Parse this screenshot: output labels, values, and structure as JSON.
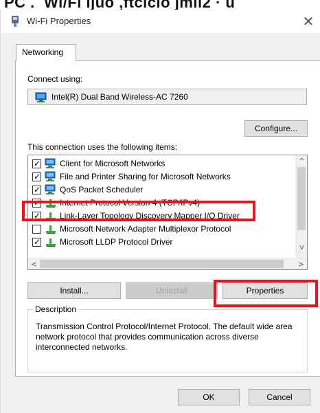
{
  "window": {
    "title": "Wi-Fi Properties",
    "close_glyph": "✕"
  },
  "tabs": [
    {
      "label": "Networking"
    }
  ],
  "connect": {
    "label": "Connect using:",
    "adapter_name": "Intel(R) Dual Band Wireless-AC 7260",
    "adapter_icon": "network-adapter-icon",
    "configure_label": "Configure..."
  },
  "items_list": {
    "label": "This connection uses the following items:",
    "items": [
      {
        "label": "Client for Microsoft Networks",
        "checked": true,
        "icon": "client-icon"
      },
      {
        "label": "File and Printer Sharing for Microsoft Networks",
        "checked": true,
        "icon": "file-printer-sharing-icon"
      },
      {
        "label": "QoS Packet Scheduler",
        "checked": true,
        "icon": "qos-icon"
      },
      {
        "label": "Internet Protocol Version 4 (TCP/IPv4)",
        "checked": true,
        "icon": "protocol-icon",
        "highlighted": true
      },
      {
        "label": "Link-Layer Topology Discovery Mapper I/O Driver",
        "checked": true,
        "icon": "protocol-icon"
      },
      {
        "label": "Microsoft Network Adapter Multiplexor Protocol",
        "checked": false,
        "icon": "protocol-icon"
      },
      {
        "label": "Microsoft LLDP Protocol Driver",
        "checked": true,
        "icon": "protocol-icon"
      }
    ],
    "scroll_up": "^",
    "scroll_down": "v",
    "scroll_left": "<",
    "scroll_right": ">"
  },
  "actions": {
    "install_label": "Install...",
    "uninstall_label": "Uninstall",
    "properties_label": "Properties"
  },
  "description": {
    "title": "Description",
    "text": "Transmission Control Protocol/Internet Protocol. The default wide area network protocol that provides communication across diverse interconnected networks."
  },
  "footer": {
    "ok_label": "OK",
    "cancel_label": "Cancel"
  },
  "colors": {
    "highlight_red": "#e8141c",
    "dialog_bg": "#f0f0f0",
    "button_bg": "#e1e1e1"
  }
}
